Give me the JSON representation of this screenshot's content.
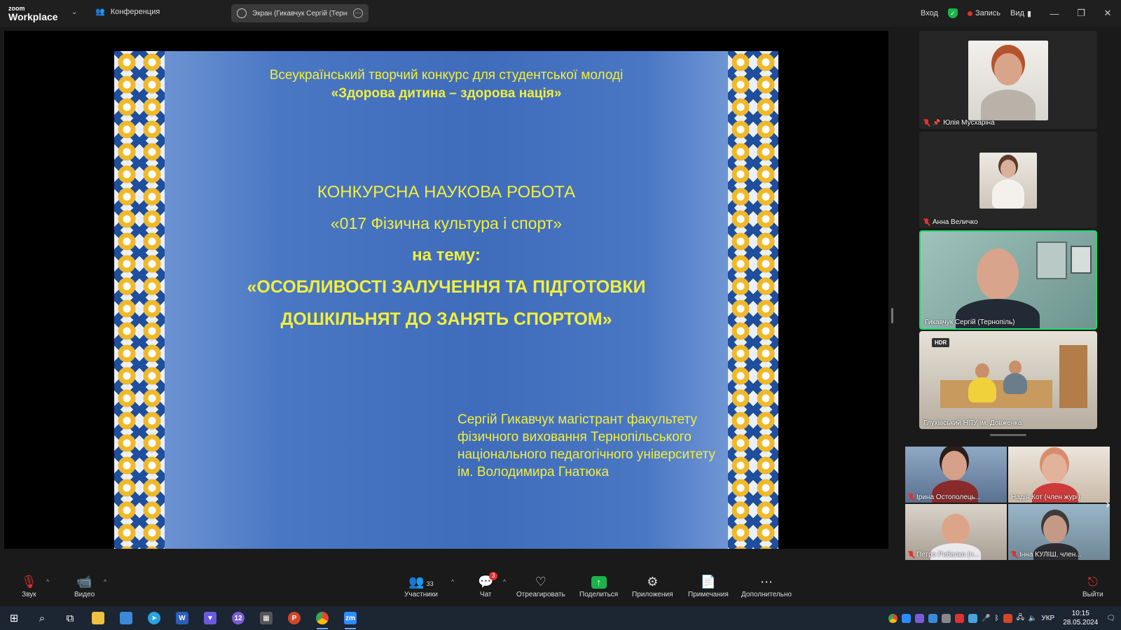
{
  "app": {
    "logo_small": "zoom",
    "logo_large": "Workplace",
    "meeting_label": "Конференция",
    "share_tab": "Экран (Гикавчук Сергій (Терног"
  },
  "titlebar_right": {
    "signin": "Вход",
    "record": "Запись",
    "view": "Вид"
  },
  "slide": {
    "line1": "Всеукраїнський творчий конкурс для студентської молоді",
    "line2": "«Здорова дитина – здорова нація»",
    "line3": "КОНКУРСНА НАУКОВА РОБОТА",
    "line4": "«017 Фізична культура і спорт»",
    "line5": "на тему:",
    "line6": "«ОСОБЛИВОСТІ ЗАЛУЧЕННЯ ТА ПІДГОТОВКИ",
    "line7": "ДОШКІЛЬНЯТ ДО ЗАНЯТЬ СПОРТОМ»",
    "author": [
      "Сергій Гикавчук магістрант факультету",
      "фізичного виховання Тернопільського",
      "національного педагогічного університету",
      "ім. Володимира Гнатюка"
    ]
  },
  "participants_panel": [
    {
      "name": "Юлія Мусхаріна"
    },
    {
      "name": "Анна Величко"
    },
    {
      "name": "Гикавчук Сергій (Тернопіль)"
    },
    {
      "name": "Глухівський НПУ ім. Довженка",
      "badge": "HDR"
    }
  ],
  "gallery": [
    {
      "name": "Ірина Остополець..."
    },
    {
      "name": "Надія Кот (член журі)"
    },
    {
      "name": "Петро Рибалко (ч..."
    },
    {
      "name": "Інна КУЛІШ, член..."
    }
  ],
  "toolbar": {
    "audio": "Звук",
    "video": "Видео",
    "participants": "Участники",
    "participants_count": "33",
    "chat": "Чат",
    "chat_badge": "3",
    "react": "Отреагировать",
    "share": "Поделиться",
    "apps": "Приложения",
    "notes": "Примечания",
    "more": "Дополнительно",
    "leave": "Выйти"
  },
  "taskbar": {
    "lang": "УКР",
    "time": "10:15",
    "date": "28.05.2024",
    "viber_badge": "12"
  },
  "colors": {
    "accent_green": "#1bb34a",
    "active_border": "#23d96b",
    "record_red": "#e0312f",
    "slide_text": "#f2ef3c"
  }
}
